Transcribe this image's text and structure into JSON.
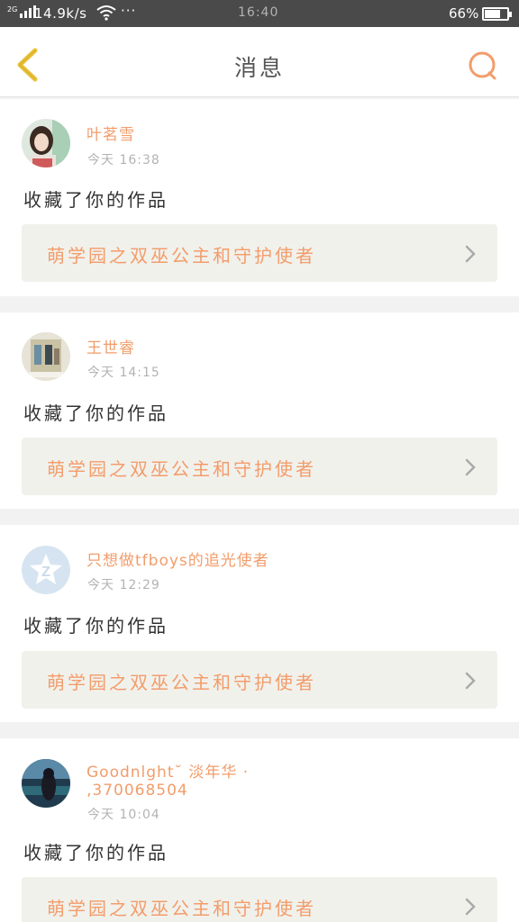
{
  "status_bar": {
    "network": "2G",
    "speed": "14.9k/s",
    "more": "···",
    "time": "16:40",
    "battery": "66%",
    "battery_level": 0.66
  },
  "header": {
    "title": "消息",
    "back_icon": "chevron-left-icon",
    "search_icon": "search-icon"
  },
  "messages": [
    {
      "name": "叶茗雪",
      "time": "今天 16:38",
      "action": "收藏了你的作品",
      "work_title": "萌学园之双巫公主和守护使者"
    },
    {
      "name": "王世睿",
      "time": "今天 14:15",
      "action": "收藏了你的作品",
      "work_title": "萌学园之双巫公主和守护使者"
    },
    {
      "name": "只想做tfboys的追光使者",
      "time": "今天 12:29",
      "action": "收藏了你的作品",
      "work_title": "萌学园之双巫公主和守护使者"
    },
    {
      "name": "Goodnlght˘ 淡年华 · ‚370068504",
      "time": "今天 10:04",
      "action": "收藏了你的作品",
      "work_title": "萌学园之双巫公主和守护使者"
    }
  ],
  "colors": {
    "accent": "#f29d6b",
    "back_icon": "#e8c23a",
    "status_bar": "#4a4a4a"
  }
}
